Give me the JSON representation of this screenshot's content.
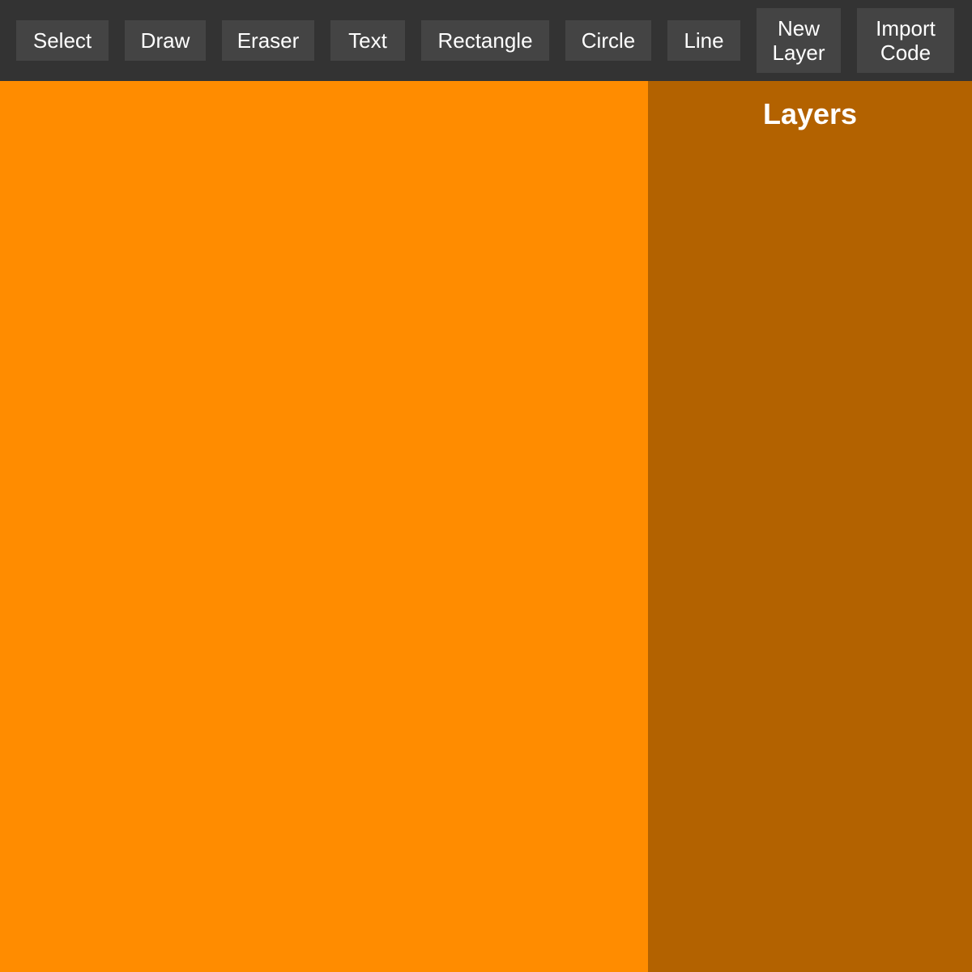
{
  "toolbar": {
    "buttons": [
      {
        "label": "Select"
      },
      {
        "label": "Draw"
      },
      {
        "label": "Eraser"
      },
      {
        "label": "Text"
      },
      {
        "label": "Rectangle"
      },
      {
        "label": "Circle"
      },
      {
        "label": "Line"
      },
      {
        "label": "New Layer"
      },
      {
        "label": "Import Code"
      }
    ]
  },
  "layers_panel": {
    "title": "Layers"
  },
  "colors": {
    "toolbar_bg": "#333333",
    "button_bg": "#444444",
    "canvas_bg": "#ff8c00",
    "panel_bg": "#b36200",
    "text": "#ffffff"
  }
}
